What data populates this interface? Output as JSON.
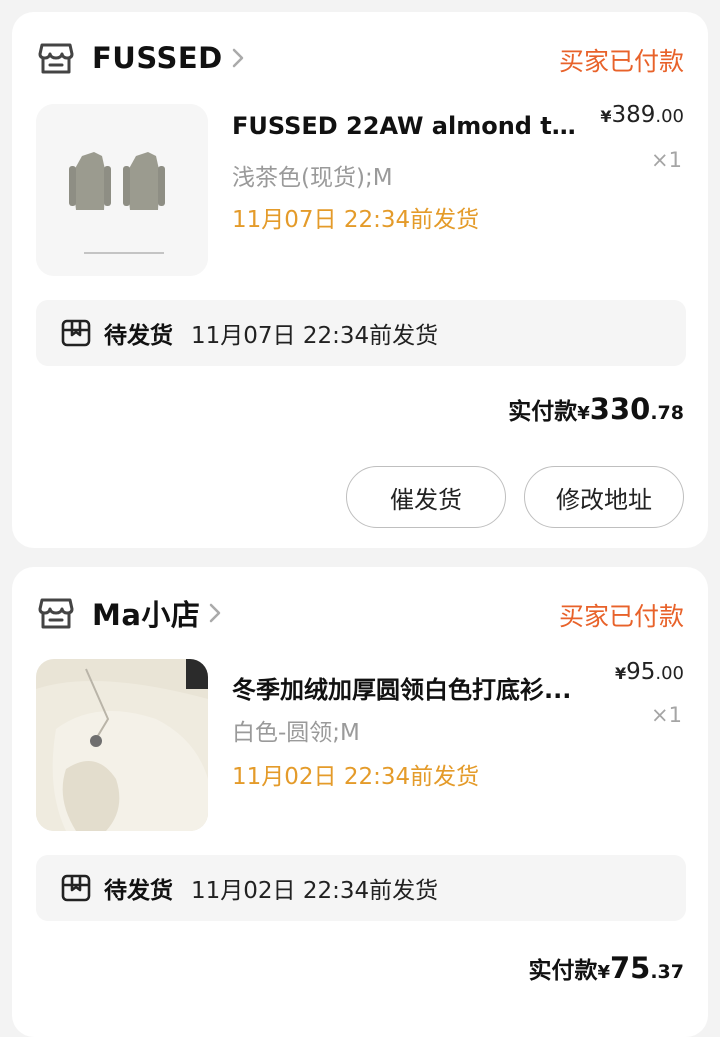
{
  "orders": [
    {
      "store": "FUSSED",
      "status": "买家已付款",
      "title": "FUSSED 22AW almond te...",
      "spec": "浅茶色(现货);M",
      "ship_deadline": "11月07日 22:34前发货",
      "price_symbol": "¥",
      "price_int": "389",
      "price_dec": ".00",
      "quantity": "×1",
      "ship_label": "待发货",
      "ship_time": "11月07日 22:34前发货",
      "paid_label": "实付款",
      "paid_symbol": "¥",
      "paid_int": "330",
      "paid_dec": ".78",
      "buttons": [
        "催发货",
        "修改地址"
      ]
    },
    {
      "store": "Ma小店",
      "status": "买家已付款",
      "title": "冬季加绒加厚圆领白色打底衫...",
      "spec": "白色-圆领;M",
      "ship_deadline": "11月02日 22:34前发货",
      "price_symbol": "¥",
      "price_int": "95",
      "price_dec": ".00",
      "quantity": "×1",
      "ship_label": "待发货",
      "ship_time": "11月02日 22:34前发货",
      "paid_label": "实付款",
      "paid_symbol": "¥",
      "paid_int": "75",
      "paid_dec": ".37"
    }
  ],
  "colors": {
    "status": "#e8622a",
    "ship_deadline": "#e49b2a",
    "background": "#f3f3f3"
  }
}
